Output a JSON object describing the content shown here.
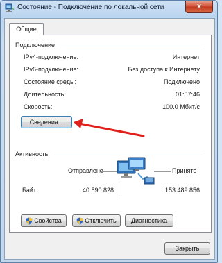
{
  "window": {
    "title": "Состояние - Подключение по локальной сети",
    "close_glyph": "x"
  },
  "tabs": [
    {
      "label": "Общие"
    }
  ],
  "connection": {
    "group_label": "Подключение",
    "rows": [
      {
        "label": "IPv4-подключение:",
        "value": "Интернет"
      },
      {
        "label": "IPv6-подключение:",
        "value": "Без доступа к Интернету"
      },
      {
        "label": "Состояние среды:",
        "value": "Подключено"
      },
      {
        "label": "Длительность:",
        "value": "01:57:46"
      },
      {
        "label": "Скорость:",
        "value": "100.0 Мбит/с"
      }
    ],
    "details_button": "Сведения..."
  },
  "activity": {
    "group_label": "Активность",
    "sent_label": "Отправлено",
    "received_label": "Принято",
    "bytes_label": "Байт:",
    "bytes_sent": "40 590 828",
    "bytes_received": "153 489 856"
  },
  "buttons": {
    "properties": "Свойства",
    "disable": "Отключить",
    "diagnose": "Диагностика",
    "close": "Закрыть"
  },
  "icons": {
    "title": "network-icon",
    "activity": "network-computers-icon",
    "shield": "uac-shield-icon",
    "annotation": "red-arrow"
  },
  "colors": {
    "arrow": "#e0201b",
    "close_button": "#c9432a"
  }
}
